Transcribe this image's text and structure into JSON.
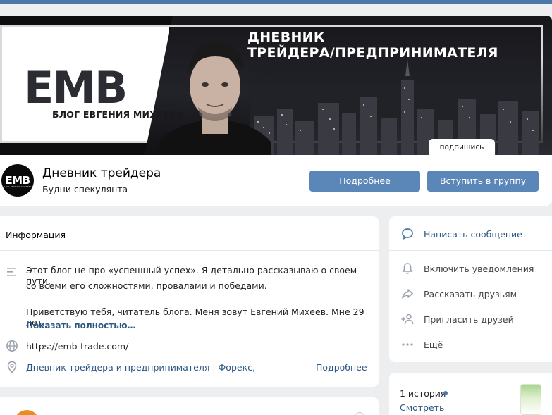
{
  "cover": {
    "logo_text": "EMB",
    "logo_subtitle": "БЛОГ ЕВГЕНИЯ МИХЕЕВА",
    "headline_line1": "ДНЕВНИК",
    "headline_line2": "ТРЕЙДЕРА/ПРЕДПРИНИМАТЕЛЯ",
    "subscribed_label": "подпишись"
  },
  "group": {
    "avatar_text": "EMB",
    "avatar_small_text": "БЛОГ ЕВГЕНИЯ МИХЕЕВА",
    "name": "Дневник трейдера",
    "status": "Будни спекулянта",
    "more_button": "Подробнее",
    "join_button": "Вступить в группу"
  },
  "info": {
    "title": "Информация",
    "about_line1": "Этот блог не про «успешный успех». Я детально рассказываю о своем пути,",
    "about_line2": "со всеми его сложностями, провалами и победами.",
    "about_line3": "Приветствую тебя, читатель блога. Меня зовут Евгений Михеев. Мне 29 лет.",
    "show_more": "Показать полностью…",
    "website": "https://emb-trade.com/",
    "place": "Дневник трейдера и предпринимателя | Форекс,",
    "place_more": "Подробнее"
  },
  "actions": {
    "message": "Написать сообщение",
    "notifications": "Включить уведомления",
    "share": "Рассказать друзьям",
    "invite": "Пригласить друзей",
    "more": "Ещё"
  },
  "stories": {
    "count": "1 история",
    "view": "Смотреть"
  },
  "colors": {
    "accent": "#5b86b8",
    "link": "#2a5885",
    "page_bg": "#edeef0",
    "topbar": "#4a76a8"
  }
}
